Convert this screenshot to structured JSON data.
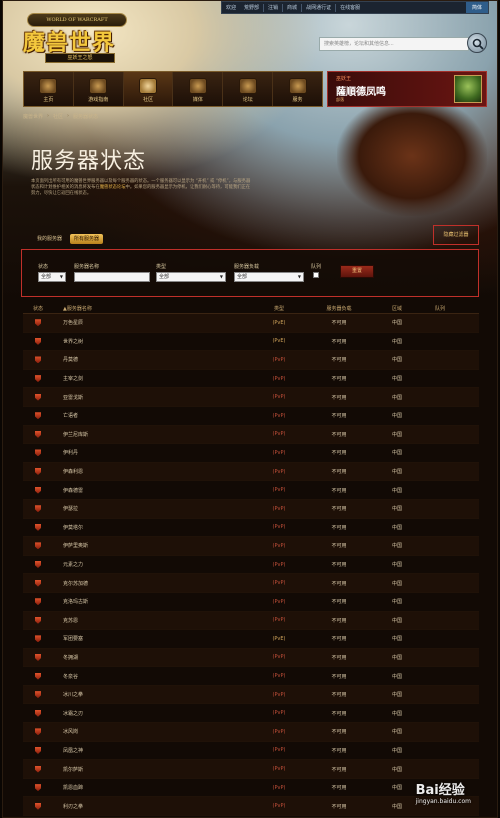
{
  "topbar": {
    "welcome": "欢迎",
    "user": "荒野部",
    "logout": "注销",
    "store": "商城",
    "battlenet": "战网通行证",
    "support": "在线客服",
    "lang": "简体"
  },
  "logo": {
    "ring": "WORLD OF WARCRAFT",
    "main": "魔兽世界",
    "sub": "巫妖王之怒"
  },
  "search": {
    "placeholder": "搜索英雄榜，论坛和其他信息..."
  },
  "nav": [
    {
      "label": "主页",
      "icon": "home-icon"
    },
    {
      "label": "游戏指南",
      "icon": "guide-icon"
    },
    {
      "label": "社区",
      "icon": "community-icon"
    },
    {
      "label": "媒体",
      "icon": "media-icon"
    },
    {
      "label": "论坛",
      "icon": "forum-icon"
    },
    {
      "label": "服务",
      "icon": "services-icon"
    }
  ],
  "account": {
    "realm": "巫妖王",
    "name": "薩順德凤鸣",
    "level": "部落"
  },
  "breadcrumb": [
    "魔兽世界",
    "社区",
    "服务器状态"
  ],
  "page": {
    "title": "服务器状态",
    "desc_1": "本页面列出所有可用的魔兽世界服务器以及每个服务器的状态。一个服务器可以显示为 “开机” 或 “停机”，与服务器状态和计划维护相关的消息将发布在",
    "desc_hl": "魔兽状态论坛",
    "desc_2": "中。如果您的服务器显示为停机，让我们耐心等待，可能我们正在努力，尽快让它返回在线状态。"
  },
  "tabs": {
    "mine": "我的服务器",
    "all": "所有服务器"
  },
  "hide_filter": "隐藏过滤器",
  "filter": {
    "status_label": "状态",
    "status_value": "全部",
    "name_label": "服务器名称",
    "type_label": "类型",
    "type_value": "全部",
    "load_label": "服务器负载",
    "load_value": "全部",
    "queue_label": "队列",
    "reset": "重置"
  },
  "table": {
    "headers": {
      "status": "状态",
      "name": "▲服务器名称",
      "type": "类型",
      "load": "服务器负载",
      "region": "区域",
      "queue": "队列"
    },
    "rows": [
      {
        "name": "万色星辰",
        "type": "(PvE)",
        "load": "不可用",
        "region": "中国"
      },
      {
        "name": "世界之树",
        "type": "(PvE)",
        "load": "不可用",
        "region": "中国"
      },
      {
        "name": "丹莫德",
        "type": "(PvP)",
        "load": "不可用",
        "region": "中国"
      },
      {
        "name": "主宰之剑",
        "type": "(PvP)",
        "load": "不可用",
        "region": "中国"
      },
      {
        "name": "亚雷戈斯",
        "type": "(PvP)",
        "load": "不可用",
        "region": "中国"
      },
      {
        "name": "亡语者",
        "type": "(PvP)",
        "load": "不可用",
        "region": "中国"
      },
      {
        "name": "伊兰尼库斯",
        "type": "(PvP)",
        "load": "不可用",
        "region": "中国"
      },
      {
        "name": "伊利丹",
        "type": "(PvP)",
        "load": "不可用",
        "region": "中国"
      },
      {
        "name": "伊森利恩",
        "type": "(PvP)",
        "load": "不可用",
        "region": "中国"
      },
      {
        "name": "伊森德雷",
        "type": "(PvP)",
        "load": "不可用",
        "region": "中国"
      },
      {
        "name": "伊瑟拉",
        "type": "(PvP)",
        "load": "不可用",
        "region": "中国"
      },
      {
        "name": "伊莫塔尔",
        "type": "(PvP)",
        "load": "不可用",
        "region": "中国"
      },
      {
        "name": "伊萨里奥斯",
        "type": "(PvP)",
        "load": "不可用",
        "region": "中国"
      },
      {
        "name": "元素之力",
        "type": "(PvP)",
        "load": "不可用",
        "region": "中国"
      },
      {
        "name": "克尔苏加德",
        "type": "(PvP)",
        "load": "不可用",
        "region": "中国"
      },
      {
        "name": "克洛玛古斯",
        "type": "(PvP)",
        "load": "不可用",
        "region": "中国"
      },
      {
        "name": "克苏恩",
        "type": "(PvP)",
        "load": "不可用",
        "region": "中国"
      },
      {
        "name": "军团要塞",
        "type": "(PvE)",
        "load": "不可用",
        "region": "中国"
      },
      {
        "name": "冬拥湖",
        "type": "(PvP)",
        "load": "不可用",
        "region": "中国"
      },
      {
        "name": "冬泉谷",
        "type": "(PvP)",
        "load": "不可用",
        "region": "中国"
      },
      {
        "name": "冰川之拳",
        "type": "(PvP)",
        "load": "不可用",
        "region": "中国"
      },
      {
        "name": "冰霜之刃",
        "type": "(PvP)",
        "load": "不可用",
        "region": "中国"
      },
      {
        "name": "冰风岗",
        "type": "(PvP)",
        "load": "不可用",
        "region": "中国"
      },
      {
        "name": "凤凰之神",
        "type": "(PvP)",
        "load": "不可用",
        "region": "中国"
      },
      {
        "name": "凯尔萨斯",
        "type": "(PvP)",
        "load": "不可用",
        "region": "中国"
      },
      {
        "name": "凯恩血蹄",
        "type": "(PvP)",
        "load": "不可用",
        "region": "中国"
      },
      {
        "name": "利刃之拳",
        "type": "(PvP)",
        "load": "不可用",
        "region": "中国"
      }
    ]
  },
  "watermark": {
    "main": "Bai经验",
    "sub": "jingyan.baidu.com"
  }
}
